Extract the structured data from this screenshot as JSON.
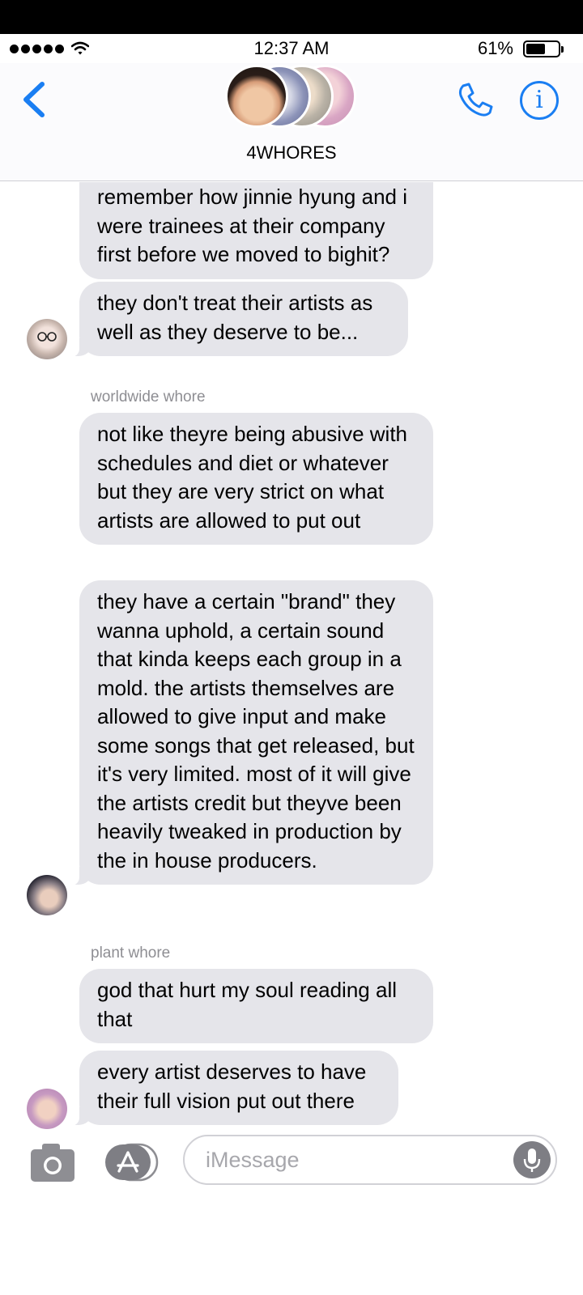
{
  "status": {
    "time": "12:37 AM",
    "battery": "61%",
    "battery_level": 0.61
  },
  "header": {
    "group_name": "4WHORES",
    "avatar_count": 4
  },
  "messages": [
    {
      "text": "remember how jinnie hyung and i were trainees at their company first before we moved to bighit?"
    },
    {
      "text": "they don't treat their artists as well as they deserve to be..."
    },
    {
      "sender": "worldwide whore",
      "text": "not like theyre being abusive with schedules and diet or whatever but they are very strict on what artists are allowed to put out"
    },
    {
      "text": "they have a certain \"brand\" they wanna uphold, a certain sound that kinda keeps each group in a mold. the artists themselves are allowed to give input and make some songs that get released, but it's very limited. most of it will give the artists credit but theyve been heavily tweaked in production by the in house producers."
    },
    {
      "sender": "plant whore",
      "text": "god that hurt my soul reading all that"
    },
    {
      "text": "every artist deserves to have their full vision put out there"
    }
  ],
  "input": {
    "placeholder": "iMessage"
  },
  "colors": {
    "accent": "#1a7ef2",
    "bubble": "#e5e5ea",
    "sender_label": "#8e8e93"
  },
  "icons": [
    "back-chevron-icon",
    "phone-icon",
    "info-icon",
    "camera-icon",
    "app-store-icon",
    "microphone-icon"
  ]
}
